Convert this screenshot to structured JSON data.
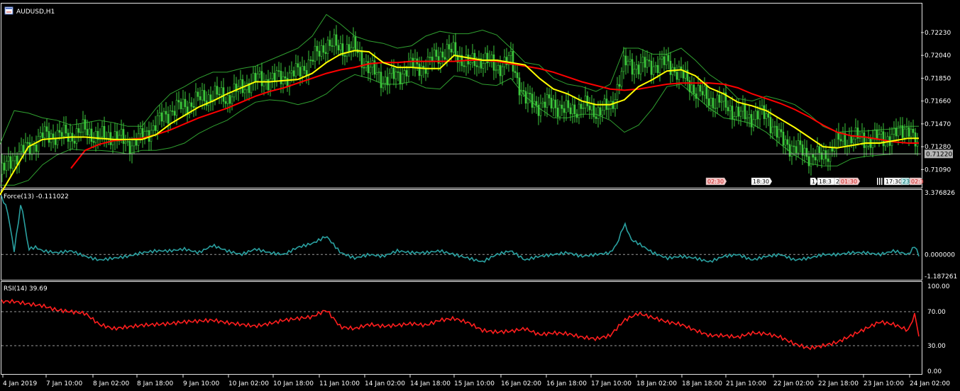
{
  "window": {
    "title": "AUDUSD,H1",
    "icon": "window-chart-icon"
  },
  "chart_data": [
    {
      "type": "line",
      "subtype": "candlestick-with-moving-averages-and-bollinger-bands",
      "title": "AUDUSD,H1",
      "ylim": [
        0.7098,
        0.7243
      ],
      "y_ticks": [
        "0.72230",
        "0.72040",
        "0.71850",
        "0.71660",
        "0.71470",
        "0.71280",
        "0.71090"
      ],
      "current_price_label": "0.71220",
      "current_price": 0.7122,
      "colors": {
        "candles": "#3cc83c",
        "ma_fast": "#ffff00",
        "ma_slow": "#ff0000",
        "bands": "#3cc83c",
        "price_line": "#b4b4b4"
      },
      "x": [
        0,
        20,
        40,
        60,
        80,
        100,
        120,
        140,
        160,
        180,
        200,
        220,
        240,
        260,
        280,
        300,
        320,
        340,
        360,
        380,
        400,
        420,
        440,
        460,
        480,
        500,
        520,
        540,
        560,
        580,
        600,
        620,
        640,
        660,
        680,
        700,
        720,
        740,
        760,
        780,
        800,
        820,
        840,
        860,
        880,
        900,
        920,
        940,
        960,
        980,
        1000,
        1020,
        1040,
        1060,
        1080,
        1100,
        1120,
        1140,
        1160,
        1180,
        1200,
        1220,
        1240,
        1260,
        1280,
        1295
      ],
      "series": [
        {
          "role": "price",
          "values": [
            0.7105,
            0.712,
            0.7127,
            0.7137,
            0.7138,
            0.7137,
            0.7142,
            0.7135,
            0.7138,
            0.713,
            0.7136,
            0.7147,
            0.7158,
            0.7162,
            0.7167,
            0.7171,
            0.7169,
            0.7177,
            0.7184,
            0.7184,
            0.7186,
            0.719,
            0.72,
            0.7214,
            0.721,
            0.721,
            0.7193,
            0.7184,
            0.7187,
            0.7196,
            0.7195,
            0.7206,
            0.7207,
            0.7196,
            0.7201,
            0.7194,
            0.72,
            0.7167,
            0.7163,
            0.7164,
            0.7157,
            0.7162,
            0.7158,
            0.7159,
            0.7197,
            0.7195,
            0.7196,
            0.7198,
            0.7188,
            0.7175,
            0.7167,
            0.7164,
            0.7155,
            0.7153,
            0.7155,
            0.7134,
            0.7127,
            0.7121,
            0.7119,
            0.7132,
            0.7136,
            0.7133,
            0.7135,
            0.7137,
            0.7146,
            0.7122
          ]
        },
        {
          "role": "ma_fast",
          "values": [
            0.7088,
            0.7108,
            0.7128,
            0.7134,
            0.7135,
            0.7136,
            0.7136,
            0.7135,
            0.7134,
            0.7134,
            0.7134,
            0.7138,
            0.7147,
            0.7154,
            0.7161,
            0.7166,
            0.7172,
            0.7177,
            0.7182,
            0.7182,
            0.7183,
            0.7184,
            0.7189,
            0.7198,
            0.7205,
            0.7208,
            0.7207,
            0.7198,
            0.7194,
            0.7194,
            0.7193,
            0.7193,
            0.7204,
            0.7202,
            0.72,
            0.72,
            0.7198,
            0.7196,
            0.7185,
            0.7176,
            0.7172,
            0.7166,
            0.7163,
            0.7163,
            0.7167,
            0.7178,
            0.7184,
            0.7191,
            0.7192,
            0.7187,
            0.7177,
            0.7172,
            0.7165,
            0.7162,
            0.7158,
            0.7151,
            0.7144,
            0.7136,
            0.7128,
            0.7127,
            0.7129,
            0.7131,
            0.7131,
            0.7133,
            0.7135,
            0.7135
          ]
        },
        {
          "role": "ma_slow",
          "values": [
            null,
            null,
            null,
            null,
            null,
            0.711,
            0.7125,
            0.713,
            0.7133,
            0.7134,
            0.7135,
            0.7138,
            0.7142,
            0.7147,
            0.7152,
            0.7156,
            0.716,
            0.7165,
            0.717,
            0.7174,
            0.7177,
            0.7181,
            0.7185,
            0.7189,
            0.7192,
            0.7194,
            0.7197,
            0.7198,
            0.7198,
            0.7199,
            0.7199,
            0.7199,
            0.7199,
            0.72,
            0.72,
            0.7199,
            0.7197,
            0.7195,
            0.7193,
            0.719,
            0.7186,
            0.7182,
            0.7179,
            0.7176,
            0.7175,
            0.7176,
            0.7178,
            0.718,
            0.7181,
            0.7181,
            0.7181,
            0.718,
            0.7177,
            0.7172,
            0.7168,
            0.7164,
            0.7159,
            0.7153,
            0.7146,
            0.714,
            0.7137,
            0.7136,
            0.7134,
            0.7132,
            0.7131,
            0.7131
          ]
        },
        {
          "role": "band_upper",
          "values": [
            0.713,
            0.7158,
            0.7156,
            0.7152,
            0.715,
            0.7146,
            0.7148,
            0.715,
            0.7148,
            0.7145,
            0.7145,
            0.716,
            0.7172,
            0.7178,
            0.7185,
            0.719,
            0.719,
            0.7193,
            0.7195,
            0.72,
            0.7205,
            0.721,
            0.722,
            0.7238,
            0.723,
            0.722,
            0.7216,
            0.7214,
            0.721,
            0.7212,
            0.722,
            0.7224,
            0.7222,
            0.7222,
            0.7225,
            0.7221,
            0.721,
            0.7198,
            0.7196,
            0.7185,
            0.718,
            0.7178,
            0.7174,
            0.718,
            0.721,
            0.721,
            0.7205,
            0.7205,
            0.721,
            0.72,
            0.7188,
            0.718,
            0.7168,
            0.7166,
            0.717,
            0.7167,
            0.7163,
            0.7155,
            0.7145,
            0.714,
            0.7141,
            0.7141,
            0.7142,
            0.7143,
            0.7145,
            0.7145
          ]
        },
        {
          "role": "band_lower",
          "values": [
            0.7096,
            0.7096,
            0.71,
            0.7113,
            0.7121,
            0.7126,
            0.7125,
            0.7125,
            0.7124,
            0.7122,
            0.7125,
            0.7125,
            0.7127,
            0.7131,
            0.7139,
            0.7145,
            0.715,
            0.7158,
            0.7165,
            0.7167,
            0.7166,
            0.7163,
            0.7166,
            0.7172,
            0.7182,
            0.7188,
            0.7185,
            0.718,
            0.718,
            0.7182,
            0.7177,
            0.7176,
            0.7187,
            0.7185,
            0.718,
            0.7179,
            0.7185,
            0.717,
            0.716,
            0.7152,
            0.7152,
            0.7155,
            0.7155,
            0.715,
            0.714,
            0.7146,
            0.716,
            0.7178,
            0.718,
            0.717,
            0.716,
            0.7152,
            0.715,
            0.7147,
            0.714,
            0.713,
            0.7121,
            0.7114,
            0.7112,
            0.7112,
            0.7118,
            0.712,
            0.7121,
            0.7122,
            0.7122,
            0.7122
          ]
        }
      ]
    },
    {
      "type": "line",
      "title": "Force(13) -0.111022",
      "ylim": [
        -1.187261,
        3.376826
      ],
      "y_ticks": [
        "3.376826",
        "0.000000",
        "-1.187261"
      ],
      "reference_line": 0.0,
      "color": "#2aa1a1",
      "x": [
        0,
        10,
        20,
        30,
        40,
        50,
        60,
        80,
        100,
        120,
        140,
        160,
        180,
        200,
        220,
        240,
        260,
        280,
        300,
        320,
        340,
        360,
        380,
        400,
        420,
        440,
        460,
        480,
        500,
        520,
        540,
        560,
        580,
        600,
        620,
        640,
        660,
        680,
        700,
        720,
        740,
        760,
        780,
        800,
        820,
        840,
        860,
        870,
        880,
        890,
        900,
        920,
        940,
        960,
        980,
        1000,
        1020,
        1040,
        1060,
        1080,
        1100,
        1120,
        1140,
        1160,
        1180,
        1200,
        1220,
        1240,
        1260,
        1280,
        1290,
        1295
      ],
      "values": [
        3.3,
        2.5,
        0.2,
        2.9,
        0.3,
        0.4,
        0.2,
        0.1,
        0.2,
        -0.1,
        -0.3,
        -0.2,
        -0.1,
        0.1,
        0.2,
        0.2,
        0.3,
        0.1,
        0.5,
        0.2,
        0.0,
        0.3,
        0.1,
        0.0,
        0.4,
        0.6,
        1.0,
        0.1,
        -0.2,
        0.0,
        -0.1,
        0.2,
        0.1,
        0.1,
        0.2,
        0.0,
        -0.2,
        -0.4,
        0.0,
        0.2,
        -0.3,
        -0.1,
        0.0,
        0.1,
        -0.1,
        0.0,
        0.1,
        0.6,
        1.7,
        0.8,
        0.6,
        0.1,
        -0.2,
        -0.1,
        -0.2,
        -0.4,
        -0.1,
        0.0,
        -0.3,
        -0.1,
        0.0,
        -0.3,
        -0.2,
        0.0,
        0.0,
        0.1,
        0.1,
        0.0,
        0.2,
        0.0,
        0.5,
        -0.1
      ]
    },
    {
      "type": "line",
      "title": "RSI(14) 39.69",
      "ylim": [
        0,
        100
      ],
      "y_ticks": [
        "100.00",
        "70.00",
        "30.00",
        "0.00"
      ],
      "reference_lines": [
        70,
        30
      ],
      "color": "#ff1e1e",
      "x": [
        0,
        20,
        40,
        60,
        80,
        100,
        120,
        140,
        160,
        180,
        200,
        220,
        240,
        260,
        280,
        300,
        320,
        340,
        360,
        380,
        400,
        420,
        440,
        460,
        480,
        500,
        520,
        540,
        560,
        580,
        600,
        620,
        640,
        660,
        680,
        700,
        720,
        740,
        760,
        780,
        800,
        820,
        840,
        860,
        880,
        900,
        920,
        940,
        960,
        980,
        1000,
        1020,
        1040,
        1060,
        1080,
        1100,
        1120,
        1140,
        1160,
        1180,
        1200,
        1220,
        1240,
        1260,
        1280,
        1290,
        1295
      ],
      "values": [
        82,
        82,
        79,
        77,
        72,
        70,
        68,
        55,
        50,
        52,
        54,
        55,
        56,
        58,
        59,
        60,
        57,
        55,
        53,
        56,
        60,
        62,
        64,
        72,
        52,
        50,
        55,
        53,
        54,
        56,
        54,
        60,
        62,
        57,
        48,
        46,
        47,
        50,
        43,
        45,
        44,
        40,
        38,
        42,
        60,
        68,
        63,
        58,
        55,
        48,
        42,
        42,
        40,
        45,
        44,
        40,
        32,
        27,
        30,
        34,
        42,
        50,
        58,
        55,
        48,
        68,
        40
      ]
    }
  ],
  "x_axis_labels": [
    "4 Jan 2019",
    "7 Jan 10:00",
    "8 Jan 02:00",
    "8 Jan 18:00",
    "9 Jan 10:00",
    "10 Jan 02:00",
    "10 Jan 18:00",
    "11 Jan 10:00",
    "14 Jan 02:00",
    "14 Jan 18:00",
    "15 Jan 10:00",
    "16 Jan 02:00",
    "16 Jan 18:00",
    "17 Jan 10:00",
    "18 Jan 02:00",
    "18 Jan 18:00",
    "21 Jan 10:00",
    "22 Jan 02:00",
    "22 Jan 18:00",
    "23 Jan 10:00",
    "24 Jan 02:00"
  ],
  "event_markers": [
    {
      "label": "02:30",
      "kind": "red"
    },
    {
      "label": "18:30",
      "kind": "white"
    },
    {
      "label": "1",
      "kind": "white"
    },
    {
      "label": "18:3",
      "kind": "white"
    },
    {
      "label": "2",
      "kind": "white"
    },
    {
      "label": "01:30",
      "kind": "red"
    },
    {
      "label": "17:30",
      "kind": "white"
    },
    {
      "label": "23",
      "kind": "teal"
    },
    {
      "label": "02:3",
      "kind": "red"
    }
  ]
}
